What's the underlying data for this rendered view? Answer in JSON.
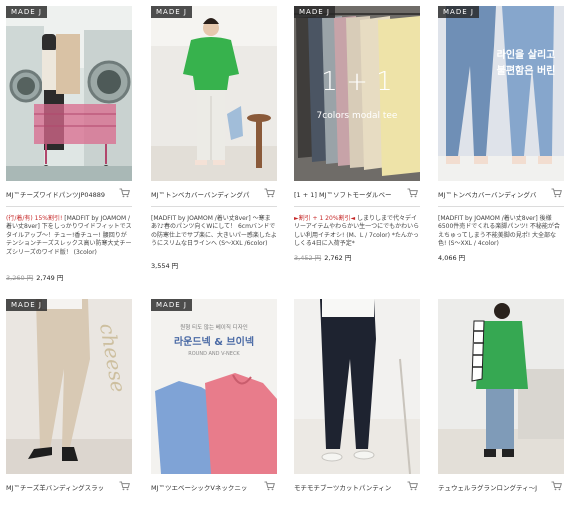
{
  "badge_text": "MADE J",
  "cart_icon": "shopping-cart-icon",
  "colors": {
    "accent_red": "#c62828",
    "text": "#333333",
    "muted": "#999999"
  },
  "products": [
    {
      "name": "MJ™チーズワイドパンツJP04889",
      "desc_highlight": "(行/着/有) 15%割引!",
      "desc": " [MADFIT by JOAMOM /着い丈8ver] 下をしっかりワイドフィットでスタイルアップ～！チュー!香チュー! 腰回りがテンションチーズスレックス高い防寒大丈チーズシリーズのワイド版！ (3color)",
      "old_price": "3,260 円",
      "price": "2,749 円",
      "image_text": ""
    },
    {
      "name": "MJ™トンベカバーバンディングパ",
      "desc_highlight": "",
      "desc": "[MADFIT by JOAMOM /着い丈8ver] ～寒まあ?♪春のパンツ向くWにして！ 6cmバンドでの防寒仕上でサプ楽に、大きいパー感楽したようにスリムな日ラインへ (S～XXL /6color)",
      "old_price": "",
      "price": "3,554 円",
      "image_text": ""
    },
    {
      "name": "[1 + 1] MJ™ソフトモーダルベー",
      "desc_highlight": "►割引 + 1 20%割引◄",
      "desc": " しまりしまで代々デイリーアイテムやわらかい生一つにでもかわいらしい利用イチオシ! (M、L / 7color) *たんかっしくる4日に入荷予定*",
      "old_price": "3,452 円",
      "price": "2,762 円",
      "image_text": "1 + 1 7colors modal tee"
    },
    {
      "name": "MJ™トンベカバーバンディングバ",
      "desc_highlight": "",
      "desc": "[MADFIT by JOAMOM /着い丈8ver] 後様6500件売ドでくれる楽脚パンツ! 不秘能が合えちゅってしまう不能美脚の見ポ! 大全部な色! (S～XXL / 4color)",
      "old_price": "",
      "price": "4,066 円",
      "image_text": "라인을 살리고 불편함은 버린"
    },
    {
      "name": "MJ™チーズ羊バンディングスラッ",
      "desc_highlight": "",
      "desc": "",
      "old_price": "",
      "price": "",
      "image_text": "cheese"
    },
    {
      "name": "MJ™ツエベーシックVネックニッ",
      "desc_highlight": "",
      "desc": "",
      "old_price": "",
      "price": "",
      "image_text": "원형 티도 않는 베이직 디자인 라운드넥 & 브이넥 ROUND AND V-NECK"
    },
    {
      "name": "モチモチブーツカットパンティン",
      "desc_highlight": "",
      "desc": "",
      "old_price": "",
      "price": "",
      "image_text": ""
    },
    {
      "name": "テュウェルラグランロングティ～J",
      "desc_highlight": "",
      "desc": "",
      "old_price": "",
      "price": "",
      "image_text": ""
    }
  ]
}
